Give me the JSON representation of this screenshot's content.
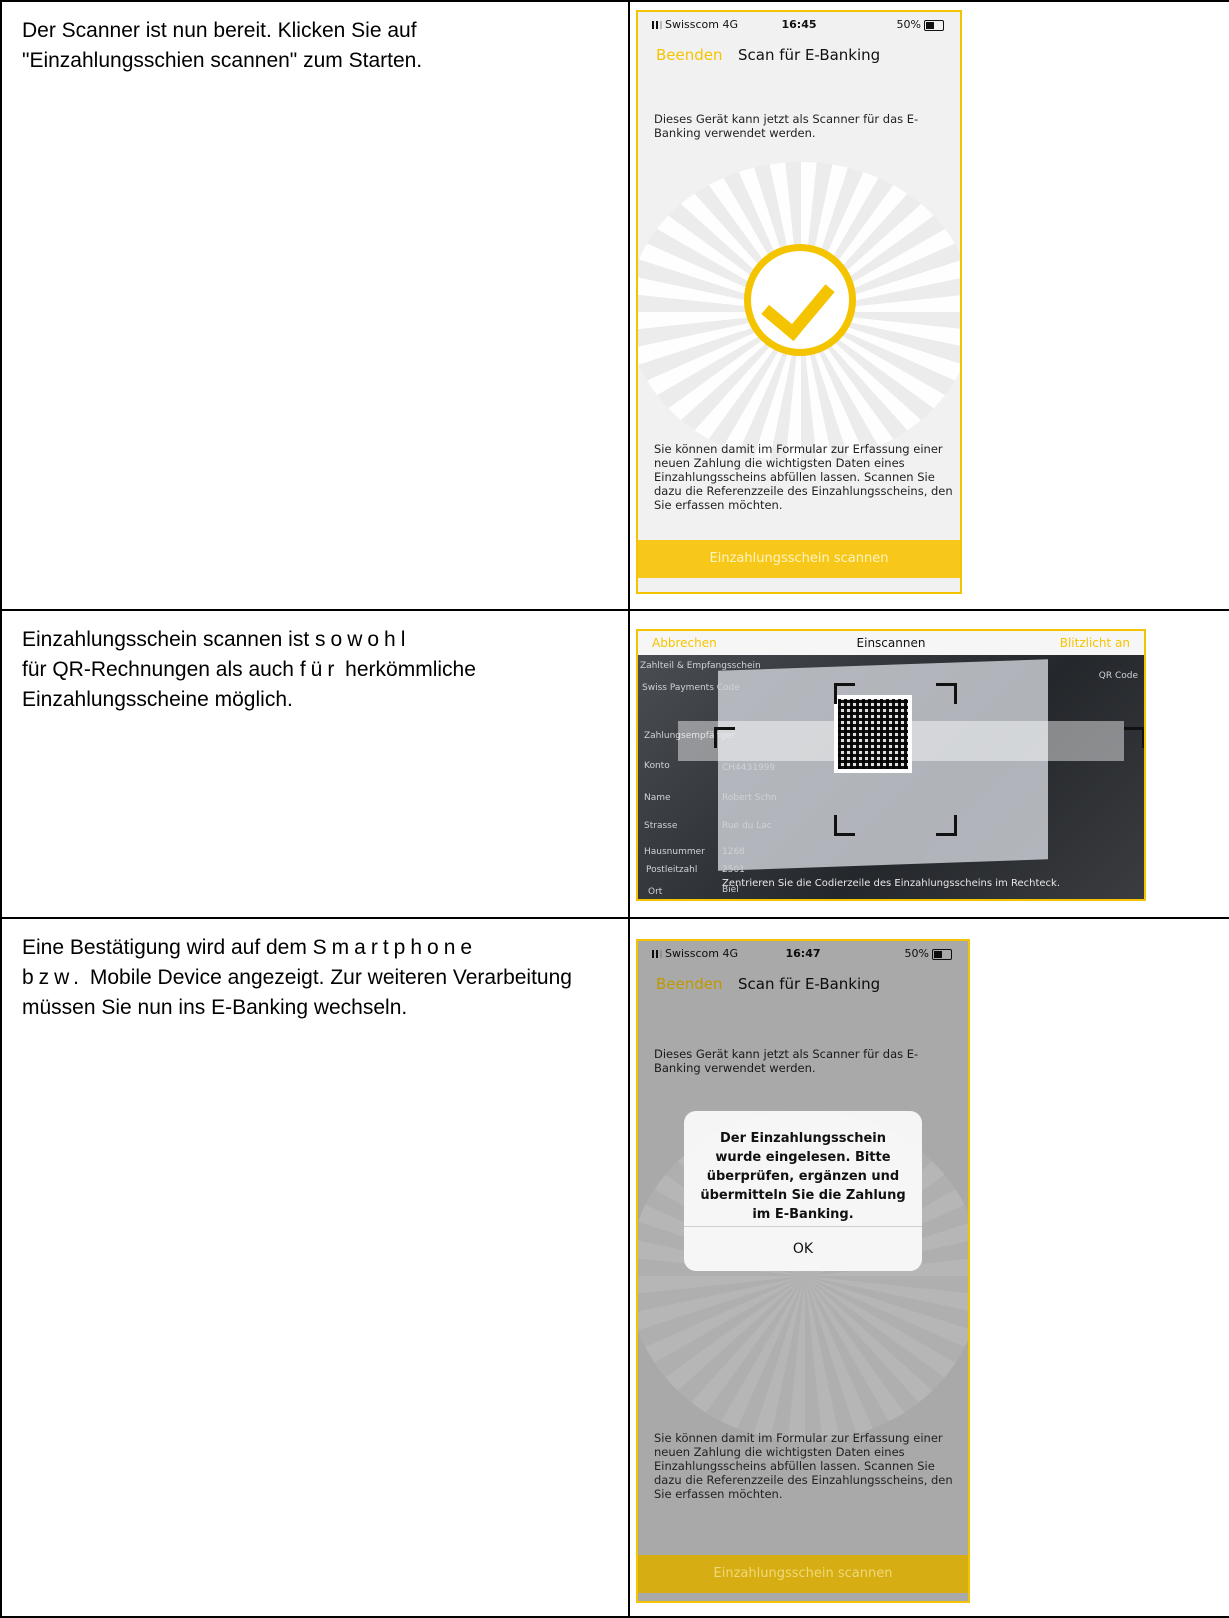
{
  "rows": [
    {
      "text": "Der Scanner ist nun bereit. Klicken Sie  auf \"Einzahlungsschien scannen\" zum  Starten."
    },
    {
      "text_a": "Einzahlungsschein scannen ist ",
      "text_sowohl": "sowohl",
      "text_b": "für QR-Rechnungen als auch ",
      "text_fuer": "für",
      "text_c": " herkömmliche Einzahlungsscheine möglich."
    },
    {
      "text_a": "Eine Bestätigung wird auf dem ",
      "text_smart": "Smartphone",
      "text_bzw": "bzw.",
      "text_c": " Mobile Device angezeigt. Zur weiteren Verarbeitung müssen Sie nun ins E-Banking wechseln."
    }
  ],
  "phone1": {
    "carrier": "Swisscom  4G",
    "time": "16:45",
    "battery": "50%",
    "nav_left": "Beenden",
    "nav_title": "Scan für E-Banking",
    "intro": "Dieses Gerät kann jetzt als Scanner für das E-Banking verwendet werden.",
    "detail": "Sie können damit im Formular zur Erfassung einer neuen Zahlung die wichtigsten Daten eines Einzahlungsscheins abfüllen lassen. Scannen Sie dazu die Referenzzeile des Einzahlungsscheins, den Sie erfassen möchten.",
    "cta": "Einzahlungsschein scannen"
  },
  "camera": {
    "nav_left": "Abbrechen",
    "nav_title": "Einscannen",
    "nav_right": "Blitzlicht an",
    "hint": "Zentrieren Sie die Codierzeile des Einzahlungsscheins im Rechteck.",
    "side_labels": [
      "Zahlteil & Empfangsschein",
      "Swiss Payments Code",
      "Zahlungsempfänger",
      "Konto",
      "Name",
      "Strasse",
      "Hausnummer",
      "Postleitzahl",
      "Ort"
    ],
    "side_values": [
      "CH4431999",
      "Robert Schn",
      "Rue du Lac",
      "1268",
      "2501",
      "Biel"
    ],
    "qr_code_label": "QR Code"
  },
  "phone2": {
    "carrier": "Swisscom  4G",
    "time": "16:47",
    "battery": "50%",
    "nav_left": "Beenden",
    "nav_title": "Scan für E-Banking",
    "intro": "Dieses Gerät kann jetzt als Scanner für das E-Banking verwendet werden.",
    "dialog_message": "Der Einzahlungsschein wurde eingelesen. Bitte überprüfen, ergänzen und übermitteln Sie die Zahlung im E-Banking.",
    "dialog_ok": "OK",
    "detail": "Sie können damit im Formular zur Erfassung einer neuen Zahlung die wichtigsten Daten eines Einzahlungsscheins abfüllen lassen. Scannen Sie dazu die Referenzzeile des Einzahlungsscheins, den Sie erfassen möchten.",
    "cta": "Einzahlungsschein scannen"
  },
  "colors": {
    "accent": "#f5c400",
    "cta": "#f7c81a",
    "border": "#000000"
  }
}
